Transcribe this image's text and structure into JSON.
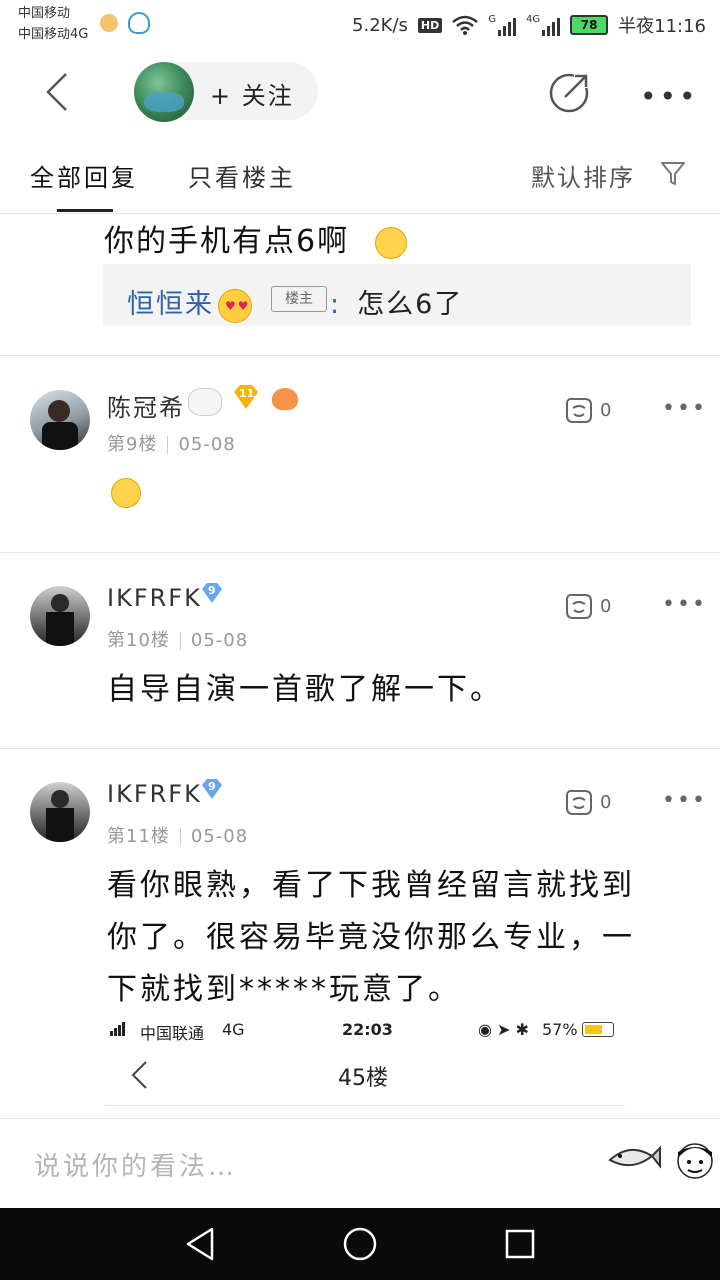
{
  "status_bar": {
    "carrier1": "中国移动",
    "carrier2": "中国移动4G",
    "speed": "5.2K/s",
    "hd": "HD",
    "net1": "G",
    "net2": "4G",
    "battery": "78",
    "time": "半夜11:16"
  },
  "top_bar": {
    "follow_label": "+ 关注",
    "icons": [
      "back-icon",
      "share-icon",
      "more-icon"
    ]
  },
  "filter": {
    "tab_all": "全部回复",
    "tab_op": "只看楼主",
    "sort": "默认排序"
  },
  "partial_reply": {
    "text": "你的手机有点6啊",
    "quote_user": "恒恒来",
    "op_tag": "楼主",
    "quote_sep": ":",
    "quote_text": "怎么6了"
  },
  "posts": [
    {
      "username": "陈冠希",
      "badge": "11",
      "floor": "第9楼",
      "date": "05-08",
      "likes": "0",
      "body": ""
    },
    {
      "username": "IKFRFK",
      "badge": "9",
      "floor": "第10楼",
      "date": "05-08",
      "likes": "0",
      "body": "自导自演一首歌了解一下。"
    },
    {
      "username": "IKFRFK",
      "badge": "9",
      "floor": "第11楼",
      "date": "05-08",
      "likes": "0",
      "body_lines": [
        "看你眼熟，看了下我曾经留言就找到",
        "你了。很容易毕竟没你那么专业，一",
        "下就找到*****玩意了。"
      ]
    }
  ],
  "embedded": {
    "carrier": "中国联通",
    "net": "4G",
    "time": "22:03",
    "battery": "57%",
    "title": "45楼"
  },
  "input": {
    "placeholder": "说说你的看法…"
  }
}
